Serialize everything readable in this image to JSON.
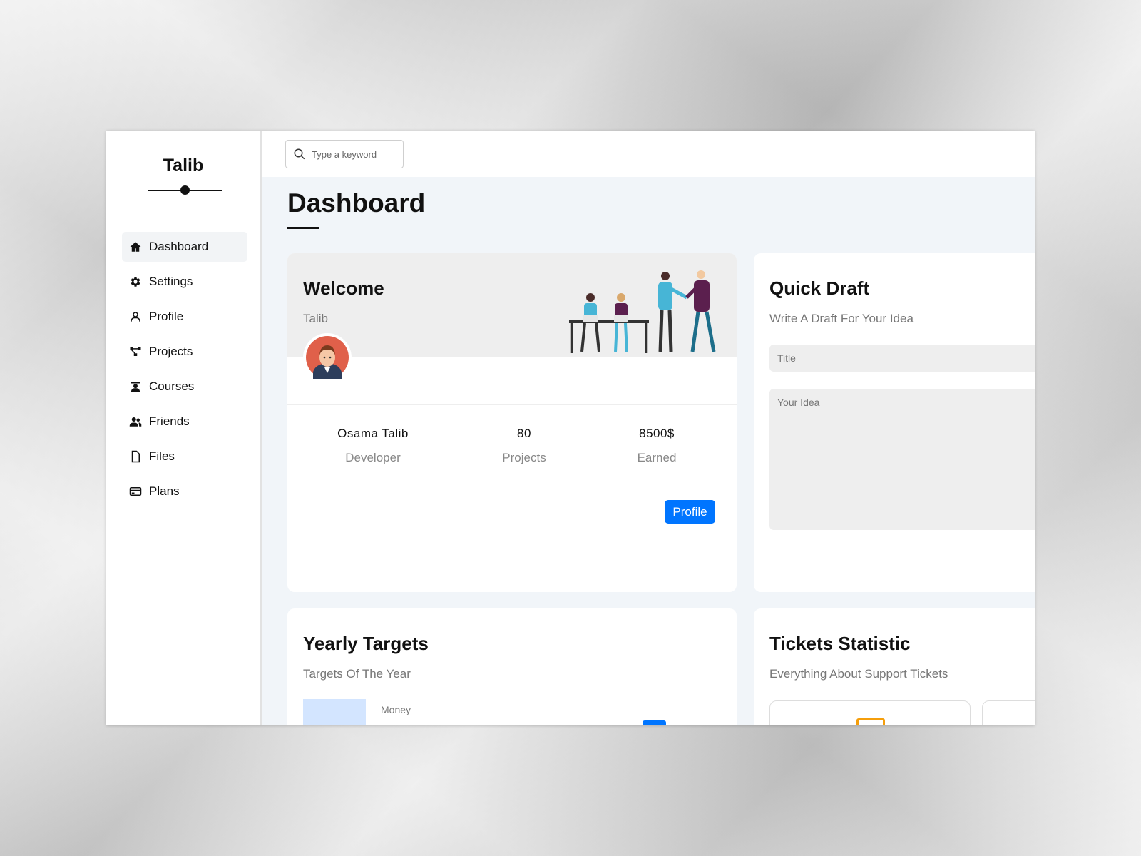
{
  "brand": {
    "name": "Talib"
  },
  "sidebar": {
    "items": [
      {
        "label": "Dashboard",
        "icon": "home-icon",
        "active": true
      },
      {
        "label": "Settings",
        "icon": "gear-icon"
      },
      {
        "label": "Profile",
        "icon": "user-icon"
      },
      {
        "label": "Projects",
        "icon": "diagram-icon"
      },
      {
        "label": "Courses",
        "icon": "graduate-icon"
      },
      {
        "label": "Friends",
        "icon": "users-icon"
      },
      {
        "label": "Files",
        "icon": "file-icon"
      },
      {
        "label": "Plans",
        "icon": "credit-card-icon"
      }
    ]
  },
  "search": {
    "placeholder": "Type a keyword"
  },
  "page": {
    "title": "Dashboard"
  },
  "welcome": {
    "title": "Welcome",
    "subtitle": "Talib",
    "stats": [
      {
        "value": "Osama Talib",
        "label": "Developer"
      },
      {
        "value": "80",
        "label": "Projects"
      },
      {
        "value": "8500$",
        "label": "Earned"
      }
    ],
    "button_label": "Profile"
  },
  "quick_draft": {
    "title": "Quick Draft",
    "subtitle": "Write A Draft For Your Idea",
    "title_placeholder": "Title",
    "idea_placeholder": "Your Idea"
  },
  "yearly_targets": {
    "title": "Yearly Targets",
    "subtitle": "Targets Of The Year",
    "first_target_label": "Money"
  },
  "tickets": {
    "title": "Tickets Statistic",
    "subtitle": "Everything About Support Tickets"
  },
  "colors": {
    "accent": "#0075ff",
    "content_bg": "#f1f5f9",
    "card_header": "#eeeeee"
  }
}
